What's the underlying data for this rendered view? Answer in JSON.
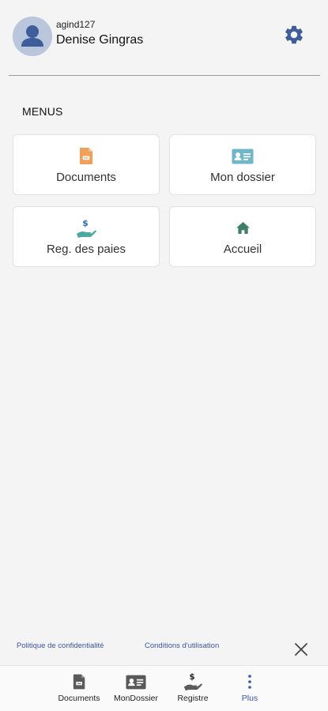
{
  "header": {
    "username": "agind127",
    "full_name": "Denise Gingras",
    "avatar_icon": "user-avatar-icon",
    "settings_icon": "gear-icon"
  },
  "menus": {
    "title": "MENUS",
    "tiles": [
      {
        "label": "Documents",
        "icon": "document-icon",
        "color": "#f0a05a"
      },
      {
        "label": "Mon dossier",
        "icon": "id-card-icon",
        "color": "#6fb7c8"
      },
      {
        "label": "Reg. des paies",
        "icon": "pay-hand-icon",
        "color": "#4aa9a0"
      },
      {
        "label": "Accueil",
        "icon": "home-icon",
        "color": "#3f7f6a"
      }
    ]
  },
  "footer": {
    "privacy_link": "Politique de confidentialité",
    "terms_link": "Conditions d'utilisation",
    "close_icon": "close-icon"
  },
  "bottom_nav": {
    "items": [
      {
        "label": "Documents",
        "icon": "document-icon"
      },
      {
        "label": "MonDossier",
        "icon": "id-card-icon"
      },
      {
        "label": "Registre",
        "icon": "pay-hand-icon"
      },
      {
        "label": "Plus",
        "icon": "more-vertical-icon",
        "active": true
      }
    ]
  },
  "colors": {
    "accent": "#3a55a8",
    "background": "#f4f4f4",
    "avatar_bg": "#b9c6dc"
  }
}
